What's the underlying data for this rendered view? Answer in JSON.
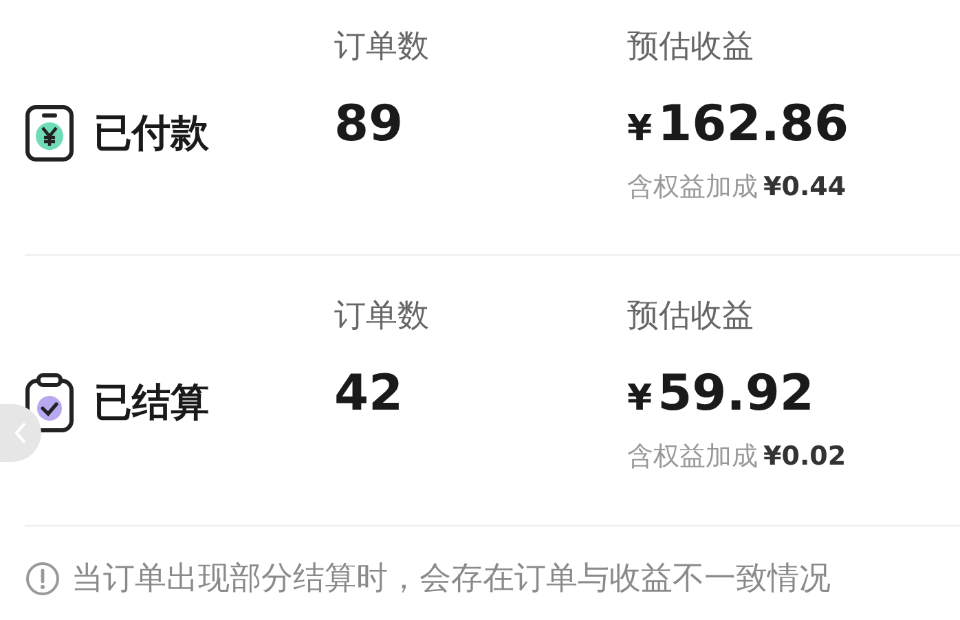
{
  "rows": [
    {
      "kind": "paid",
      "title": "已付款",
      "orders_label": "订单数",
      "orders": "89",
      "earnings_label": "预估收益",
      "currency": "¥",
      "earnings": "162.86",
      "bonus_label": "含权益加成",
      "bonus": "¥0.44"
    },
    {
      "kind": "settled",
      "title": "已结算",
      "orders_label": "订单数",
      "orders": "42",
      "earnings_label": "预估收益",
      "currency": "¥",
      "earnings": "59.92",
      "bonus_label": "含权益加成",
      "bonus": "¥0.02"
    }
  ],
  "notice": "当订单出现部分结算时，会存在订单与收益不一致情况"
}
